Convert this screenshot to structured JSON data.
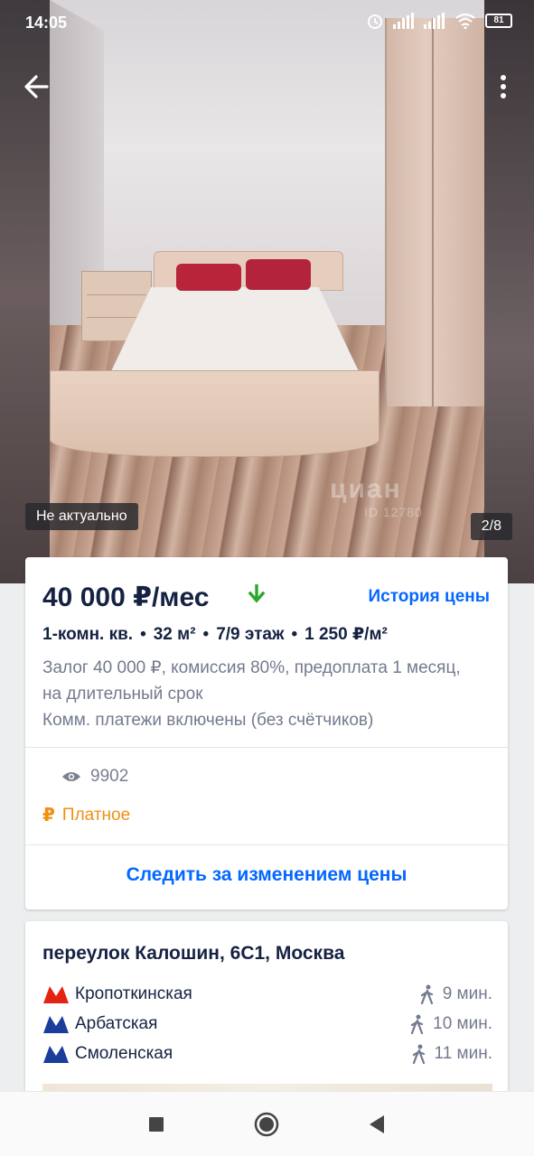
{
  "status_bar": {
    "time": "14:05",
    "battery": "81",
    "icons": [
      "alarm-icon",
      "signal-icon",
      "signal-icon",
      "wifi-icon",
      "battery-icon"
    ]
  },
  "photo": {
    "status_badge": "Не актуально",
    "counter": "2/8",
    "watermark": "циан",
    "watermark_id": "ID 12780"
  },
  "offer": {
    "price": "40 000 ₽/мес",
    "price_trend_icon": "arrow-down-icon",
    "price_trend_color": "#2ba82b",
    "history_link": "История цены",
    "params": [
      "1-комн. кв.",
      "32 м²",
      "7/9 этаж",
      "1 250 ₽/м²"
    ],
    "params_separator": "•",
    "conditions_line1": "Залог 40 000 ₽, комиссия 80%, предоплата 1 месяц, на длительный срок",
    "conditions_line2": "Комм. платежи включены (без счётчиков)",
    "views": "9902",
    "paid_symbol": "₽",
    "paid_label": "Платное",
    "track_price_link": "Следить за изменением цены"
  },
  "location": {
    "address": "переулок Калошин, 6С1, Москва",
    "metro": [
      {
        "name": "Кропоткинская",
        "time": "9 мин.",
        "color": "#e42313"
      },
      {
        "name": "Арбатская",
        "time": "10 мин.",
        "color": "#1a3d9c"
      },
      {
        "name": "Смоленская",
        "time": "11 мин.",
        "color": "#1a3d9c"
      }
    ]
  },
  "colors": {
    "accent": "#0468ff",
    "paid": "#f08f12",
    "text_primary": "#152242",
    "text_secondary": "#737a8e"
  }
}
